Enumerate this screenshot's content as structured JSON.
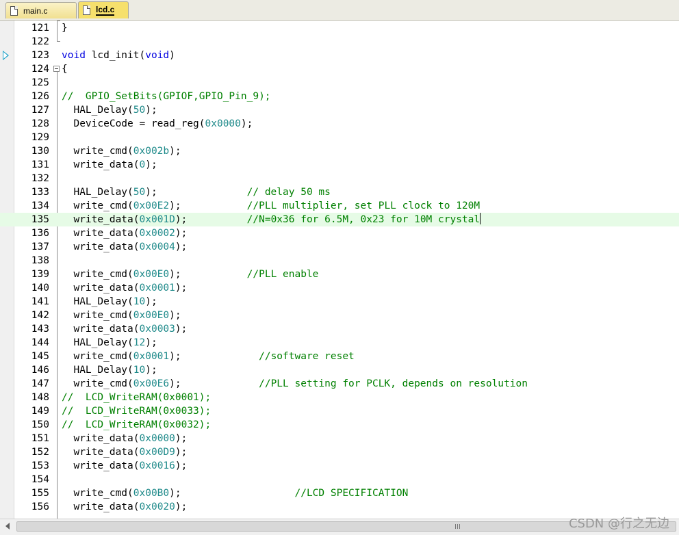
{
  "tabs": [
    {
      "label": "main.c",
      "active": false
    },
    {
      "label": "lcd.c",
      "active": true
    }
  ],
  "editor": {
    "current_line": 123,
    "highlight_line": 135,
    "lines": [
      {
        "n": "121",
        "code": "}"
      },
      {
        "n": "122",
        "code": ""
      },
      {
        "n": "123",
        "code": "void lcd_init(void)"
      },
      {
        "n": "124",
        "code": "{"
      },
      {
        "n": "125",
        "code": ""
      },
      {
        "n": "126",
        "code": "//  GPIO_SetBits(GPIOF,GPIO_Pin_9);"
      },
      {
        "n": "127",
        "code": "  HAL_Delay(50);"
      },
      {
        "n": "128",
        "code": "  DeviceCode = read_reg(0x0000);"
      },
      {
        "n": "129",
        "code": ""
      },
      {
        "n": "130",
        "code": "  write_cmd(0x002b);"
      },
      {
        "n": "131",
        "code": "  write_data(0);"
      },
      {
        "n": "132",
        "code": ""
      },
      {
        "n": "133",
        "code": "  HAL_Delay(50);               // delay 50 ms"
      },
      {
        "n": "134",
        "code": "  write_cmd(0x00E2);           //PLL multiplier, set PLL clock to 120M"
      },
      {
        "n": "135",
        "code": "  write_data(0x001D);          //N=0x36 for 6.5M, 0x23 for 10M crystal"
      },
      {
        "n": "136",
        "code": "  write_data(0x0002);"
      },
      {
        "n": "137",
        "code": "  write_data(0x0004);"
      },
      {
        "n": "138",
        "code": ""
      },
      {
        "n": "139",
        "code": "  write_cmd(0x00E0);           //PLL enable"
      },
      {
        "n": "140",
        "code": "  write_data(0x0001);"
      },
      {
        "n": "141",
        "code": "  HAL_Delay(10);"
      },
      {
        "n": "142",
        "code": "  write_cmd(0x00E0);"
      },
      {
        "n": "143",
        "code": "  write_data(0x0003);"
      },
      {
        "n": "144",
        "code": "  HAL_Delay(12);"
      },
      {
        "n": "145",
        "code": "  write_cmd(0x0001);             //software reset"
      },
      {
        "n": "146",
        "code": "  HAL_Delay(10);"
      },
      {
        "n": "147",
        "code": "  write_cmd(0x00E6);             //PLL setting for PCLK, depends on resolution"
      },
      {
        "n": "148",
        "code": "//  LCD_WriteRAM(0x0001);"
      },
      {
        "n": "149",
        "code": "//  LCD_WriteRAM(0x0033);"
      },
      {
        "n": "150",
        "code": "//  LCD_WriteRAM(0x0032);"
      },
      {
        "n": "151",
        "code": "  write_data(0x0000);"
      },
      {
        "n": "152",
        "code": "  write_data(0x00D9);"
      },
      {
        "n": "153",
        "code": "  write_data(0x0016);"
      },
      {
        "n": "154",
        "code": ""
      },
      {
        "n": "155",
        "code": "  write_cmd(0x00B0);                   //LCD SPECIFICATION"
      },
      {
        "n": "156",
        "code": "  write_data(0x0020);"
      }
    ]
  },
  "scrollbar": {
    "grip_icon": "scroll-grip-icon"
  },
  "watermark": "CSDN @行之无边",
  "colors": {
    "keyword": "#0000e0",
    "number": "#1f8a8a",
    "comment": "#008000",
    "highlight": "#e6fbe6",
    "tab_active": "#f6e06c"
  }
}
